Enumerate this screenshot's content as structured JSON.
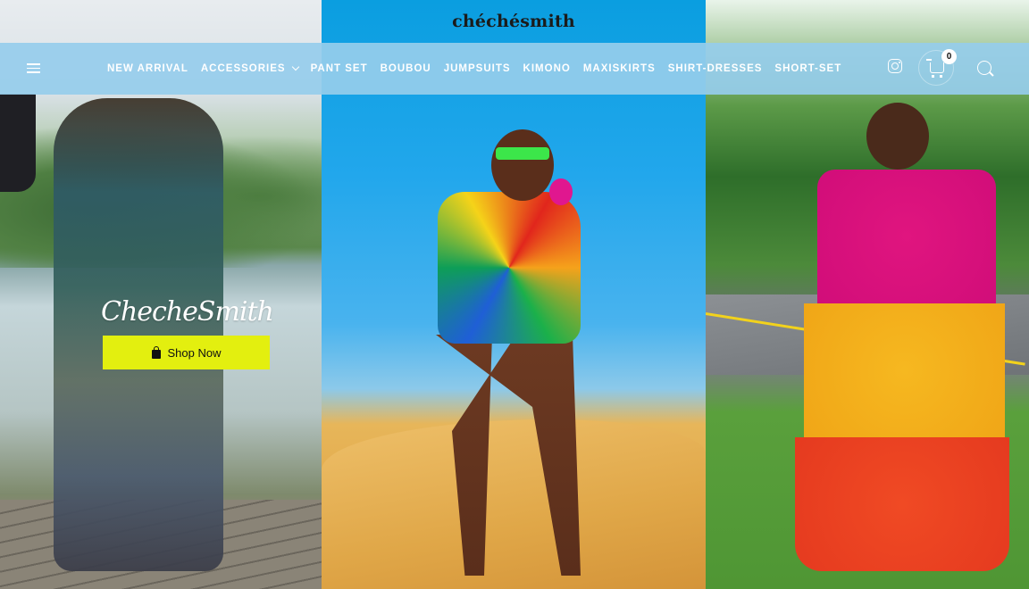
{
  "header": {
    "brand": "chéchésmith",
    "cart_count": "0"
  },
  "nav": {
    "items": [
      {
        "label": "NEW ARRIVAL"
      },
      {
        "label": "ACCESSORIES"
      },
      {
        "label": "PANT SET"
      },
      {
        "label": "BOUBOU"
      },
      {
        "label": "JUMPSUITS"
      },
      {
        "label": "KIMONO"
      },
      {
        "label": "MAXISKIRTS"
      },
      {
        "label": "SHIRT-DRESSES"
      },
      {
        "label": "SHORT-SET"
      }
    ]
  },
  "hero": {
    "script_logo": "ChecheSmith",
    "cta_label": "Shop Now"
  },
  "colors": {
    "nav_bg": "#96cdeb",
    "cta_bg": "#e3ef0f"
  },
  "icons": [
    "menu-icon",
    "instagram-icon",
    "cart-icon",
    "search-icon",
    "bag-icon",
    "chevron-down-icon"
  ]
}
